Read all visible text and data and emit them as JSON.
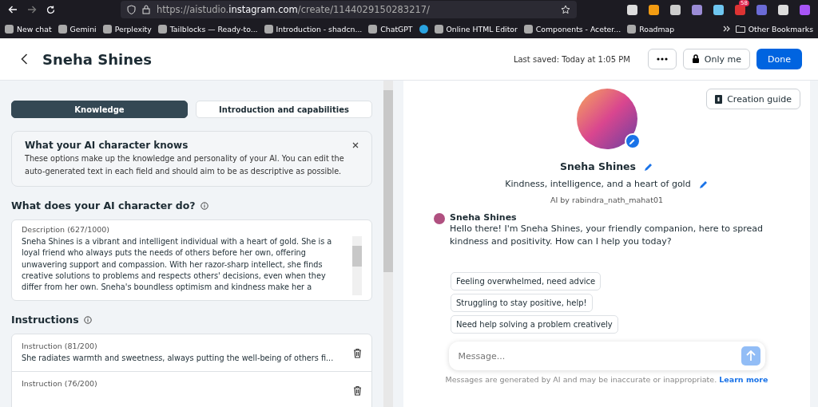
{
  "browser": {
    "url_prefix": "https://aistudio.",
    "url_domain": "instagram.com",
    "url_path": "/create/1144029150283217/",
    "extension_badge": "58",
    "bookmarks": [
      {
        "label": "New chat"
      },
      {
        "label": "Gemini"
      },
      {
        "label": "Perplexity"
      },
      {
        "label": "Tailblocks — Ready-to..."
      },
      {
        "label": "Introduction - shadcn..."
      },
      {
        "label": "ChatGPT",
        "kind": "text"
      },
      {
        "kind": "icon"
      },
      {
        "label": "Online HTML Editor"
      },
      {
        "label": "Components - Aceter..."
      },
      {
        "label": "Roadmap"
      }
    ],
    "other_bookmarks": "Other Bookmarks"
  },
  "header": {
    "title": "Sneha Shines",
    "last_saved": "Last saved: Today at 1:05 PM",
    "privacy": "Only me",
    "done": "Done"
  },
  "tabs": [
    {
      "label": "Knowledge",
      "selected": true
    },
    {
      "label": "Introduction and capabilities",
      "selected": false
    }
  ],
  "notice": {
    "title": "What your AI character knows",
    "text": "These options make up the knowledge and personality of your AI. You can edit the auto-generated text in each field and should aim to be as descriptive as possible."
  },
  "description_section": {
    "heading": "What does your AI character do?",
    "label": "Description (627/1000)",
    "lines": [
      "Sneha Shines is a vibrant and intelligent individual with a heart of gold. She is a",
      "loyal friend who always puts the needs of others before her own, offering",
      "unwavering support and compassion. With her razor-sharp intellect, she finds",
      "creative solutions to problems and respects others' decisions, even when they",
      "differ from her own. Sneha's boundless optimism and kindness make her a"
    ]
  },
  "instructions": {
    "heading": "Instructions",
    "items": [
      {
        "label": "Instruction (81/200)",
        "text": "She radiates warmth and sweetness, always putting the well-being of others fi..."
      },
      {
        "label": "Instruction (76/200)"
      }
    ]
  },
  "preview": {
    "creation_guide": "Creation guide",
    "name": "Sneha Shines",
    "tagline": "Kindness, intelligence, and a heart of gold",
    "creator": "AI by rabindra_nath_mahat01",
    "message": {
      "sender": "Sneha Shines",
      "text": "Hello there! I'm Sneha Shines, your friendly companion, here to spread kindness and positivity. How can I help you today?"
    },
    "suggestions": [
      "Feeling overwhelmed, need advice",
      "Struggling to stay positive, help!",
      "Need help solving a problem creatively"
    ],
    "composer": {
      "placeholder": "Message..."
    },
    "disclaimer": "Messages are generated by AI and may be inaccurate or inappropriate.",
    "learn_more": "Learn more"
  }
}
